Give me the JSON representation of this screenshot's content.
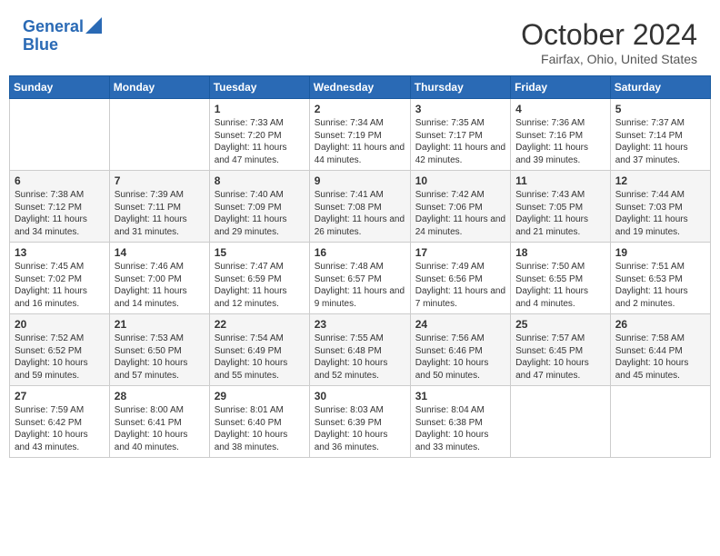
{
  "header": {
    "logo_line1": "General",
    "logo_line2": "Blue",
    "month_title": "October 2024",
    "location": "Fairfax, Ohio, United States"
  },
  "weekdays": [
    "Sunday",
    "Monday",
    "Tuesday",
    "Wednesday",
    "Thursday",
    "Friday",
    "Saturday"
  ],
  "weeks": [
    [
      {
        "day": "",
        "info": ""
      },
      {
        "day": "",
        "info": ""
      },
      {
        "day": "1",
        "info": "Sunrise: 7:33 AM\nSunset: 7:20 PM\nDaylight: 11 hours and 47 minutes."
      },
      {
        "day": "2",
        "info": "Sunrise: 7:34 AM\nSunset: 7:19 PM\nDaylight: 11 hours and 44 minutes."
      },
      {
        "day": "3",
        "info": "Sunrise: 7:35 AM\nSunset: 7:17 PM\nDaylight: 11 hours and 42 minutes."
      },
      {
        "day": "4",
        "info": "Sunrise: 7:36 AM\nSunset: 7:16 PM\nDaylight: 11 hours and 39 minutes."
      },
      {
        "day": "5",
        "info": "Sunrise: 7:37 AM\nSunset: 7:14 PM\nDaylight: 11 hours and 37 minutes."
      }
    ],
    [
      {
        "day": "6",
        "info": "Sunrise: 7:38 AM\nSunset: 7:12 PM\nDaylight: 11 hours and 34 minutes."
      },
      {
        "day": "7",
        "info": "Sunrise: 7:39 AM\nSunset: 7:11 PM\nDaylight: 11 hours and 31 minutes."
      },
      {
        "day": "8",
        "info": "Sunrise: 7:40 AM\nSunset: 7:09 PM\nDaylight: 11 hours and 29 minutes."
      },
      {
        "day": "9",
        "info": "Sunrise: 7:41 AM\nSunset: 7:08 PM\nDaylight: 11 hours and 26 minutes."
      },
      {
        "day": "10",
        "info": "Sunrise: 7:42 AM\nSunset: 7:06 PM\nDaylight: 11 hours and 24 minutes."
      },
      {
        "day": "11",
        "info": "Sunrise: 7:43 AM\nSunset: 7:05 PM\nDaylight: 11 hours and 21 minutes."
      },
      {
        "day": "12",
        "info": "Sunrise: 7:44 AM\nSunset: 7:03 PM\nDaylight: 11 hours and 19 minutes."
      }
    ],
    [
      {
        "day": "13",
        "info": "Sunrise: 7:45 AM\nSunset: 7:02 PM\nDaylight: 11 hours and 16 minutes."
      },
      {
        "day": "14",
        "info": "Sunrise: 7:46 AM\nSunset: 7:00 PM\nDaylight: 11 hours and 14 minutes."
      },
      {
        "day": "15",
        "info": "Sunrise: 7:47 AM\nSunset: 6:59 PM\nDaylight: 11 hours and 12 minutes."
      },
      {
        "day": "16",
        "info": "Sunrise: 7:48 AM\nSunset: 6:57 PM\nDaylight: 11 hours and 9 minutes."
      },
      {
        "day": "17",
        "info": "Sunrise: 7:49 AM\nSunset: 6:56 PM\nDaylight: 11 hours and 7 minutes."
      },
      {
        "day": "18",
        "info": "Sunrise: 7:50 AM\nSunset: 6:55 PM\nDaylight: 11 hours and 4 minutes."
      },
      {
        "day": "19",
        "info": "Sunrise: 7:51 AM\nSunset: 6:53 PM\nDaylight: 11 hours and 2 minutes."
      }
    ],
    [
      {
        "day": "20",
        "info": "Sunrise: 7:52 AM\nSunset: 6:52 PM\nDaylight: 10 hours and 59 minutes."
      },
      {
        "day": "21",
        "info": "Sunrise: 7:53 AM\nSunset: 6:50 PM\nDaylight: 10 hours and 57 minutes."
      },
      {
        "day": "22",
        "info": "Sunrise: 7:54 AM\nSunset: 6:49 PM\nDaylight: 10 hours and 55 minutes."
      },
      {
        "day": "23",
        "info": "Sunrise: 7:55 AM\nSunset: 6:48 PM\nDaylight: 10 hours and 52 minutes."
      },
      {
        "day": "24",
        "info": "Sunrise: 7:56 AM\nSunset: 6:46 PM\nDaylight: 10 hours and 50 minutes."
      },
      {
        "day": "25",
        "info": "Sunrise: 7:57 AM\nSunset: 6:45 PM\nDaylight: 10 hours and 47 minutes."
      },
      {
        "day": "26",
        "info": "Sunrise: 7:58 AM\nSunset: 6:44 PM\nDaylight: 10 hours and 45 minutes."
      }
    ],
    [
      {
        "day": "27",
        "info": "Sunrise: 7:59 AM\nSunset: 6:42 PM\nDaylight: 10 hours and 43 minutes."
      },
      {
        "day": "28",
        "info": "Sunrise: 8:00 AM\nSunset: 6:41 PM\nDaylight: 10 hours and 40 minutes."
      },
      {
        "day": "29",
        "info": "Sunrise: 8:01 AM\nSunset: 6:40 PM\nDaylight: 10 hours and 38 minutes."
      },
      {
        "day": "30",
        "info": "Sunrise: 8:03 AM\nSunset: 6:39 PM\nDaylight: 10 hours and 36 minutes."
      },
      {
        "day": "31",
        "info": "Sunrise: 8:04 AM\nSunset: 6:38 PM\nDaylight: 10 hours and 33 minutes."
      },
      {
        "day": "",
        "info": ""
      },
      {
        "day": "",
        "info": ""
      }
    ]
  ]
}
